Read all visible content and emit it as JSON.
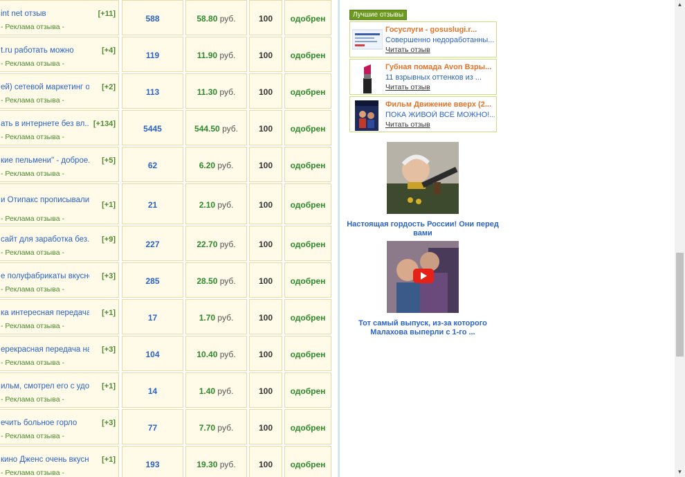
{
  "table": {
    "sub_label": "- Реклама отзыва -",
    "unit": "руб.",
    "rows": [
      {
        "title": "int net отзыв",
        "count": "[+11]",
        "views": "588",
        "sum": "58.80",
        "pct": "100",
        "status": "одобрен"
      },
      {
        "title": "t.ru работать можно",
        "count": "[+4]",
        "views": "119",
        "sum": "11.90",
        "pct": "100",
        "status": "одобрен"
      },
      {
        "title": "ей) сетевой маркетинг о...",
        "count": "[+2]",
        "views": "113",
        "sum": "11.30",
        "pct": "100",
        "status": "одобрен"
      },
      {
        "title": "ать в интернете без вл...",
        "count": "[+134]",
        "views": "5445",
        "sum": "544.50",
        "pct": "100",
        "status": "одобрен"
      },
      {
        "title": "кие пельмени\" - доброе...",
        "count": "[+5]",
        "views": "62",
        "sum": "6.20",
        "pct": "100",
        "status": "одобрен"
      },
      {
        "title": "и Отипакс прописывали",
        "count": "[+1]",
        "views": "21",
        "sum": "2.10",
        "pct": "100",
        "status": "одобрен"
      },
      {
        "title": "сайт для заработка без...",
        "count": "[+9]",
        "views": "227",
        "sum": "22.70",
        "pct": "100",
        "status": "одобрен"
      },
      {
        "title": "е полуфабрикаты вкусно ...",
        "count": "[+3]",
        "views": "285",
        "sum": "28.50",
        "pct": "100",
        "status": "одобрен"
      },
      {
        "title": "ка интересная передача,...",
        "count": "[+1]",
        "views": "17",
        "sum": "1.70",
        "pct": "100",
        "status": "одобрен"
      },
      {
        "title": "ерекрасная передача на ...",
        "count": "[+3]",
        "views": "104",
        "sum": "10.40",
        "pct": "100",
        "status": "одобрен"
      },
      {
        "title": "ильм, смотрел его с удов...",
        "count": "[+1]",
        "views": "14",
        "sum": "1.40",
        "pct": "100",
        "status": "одобрен"
      },
      {
        "title": "ечить больное горло",
        "count": "[+3]",
        "views": "77",
        "sum": "7.70",
        "pct": "100",
        "status": "одобрен"
      },
      {
        "title": "кино Дженс очень вкусно...",
        "count": "[+1]",
        "views": "193",
        "sum": "19.30",
        "pct": "100",
        "status": "одобрен"
      }
    ]
  },
  "sidebar": {
    "best_label": "Лучшие отзывы",
    "read_label": "Читать отзыв",
    "reviews": [
      {
        "title": "Госуслуги - gosuslugi.r...",
        "text": "Совершенно недоработанны...",
        "icon": "gosuslugi-thumbnail"
      },
      {
        "title": "Губная помада Avon Взры...",
        "text": "11 взрывных оттенков из ...",
        "icon": "lipstick-thumbnail"
      },
      {
        "title": "Фильм Движение вверх (2...",
        "text": "ПОКА ЖИВОЙ ВСЁ МОЖНО!...",
        "icon": "movie-poster-thumbnail"
      }
    ],
    "promos": [
      {
        "caption": "Настоящая гордость России! Они перед вами",
        "icon": "old-man-with-rifle-photo"
      },
      {
        "caption": "Тот самый выпуск, из-за которого Малахова выперли с 1-го ...",
        "icon": "tv-show-video-thumbnail"
      }
    ]
  },
  "colors": {
    "cell_bg": "#fffbe8",
    "cell_border": "#e9d9a6",
    "link_blue": "#2a63c7",
    "green": "#2c8a2c",
    "orange_title": "#e2742c",
    "badge_green": "#6c9a1f"
  }
}
